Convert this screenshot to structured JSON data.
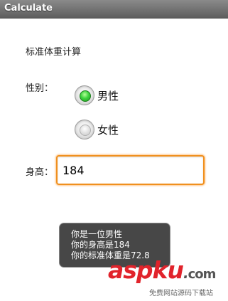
{
  "window": {
    "title": "Calculate"
  },
  "form": {
    "heading": "标准体重计算",
    "gender_label": "性别：",
    "male_label": "男性",
    "female_label": "女性",
    "selected_gender": "男性",
    "height_label": "身高：",
    "height_value": "184"
  },
  "toast": {
    "line1": "你是一位男性",
    "line2": "你的身高是184",
    "line3": "你的标准体重是72.8"
  },
  "watermark": {
    "logo_part1": "asp",
    "logo_part2": "k",
    "logo_part3": "u",
    "logo_dot": ".",
    "logo_com": "com",
    "subtitle": "免费网站源码下载站"
  },
  "colors": {
    "accent_focus": "#f0901e",
    "radio_selected": "#3fd43f",
    "titlebar": "#6e6e6e"
  }
}
